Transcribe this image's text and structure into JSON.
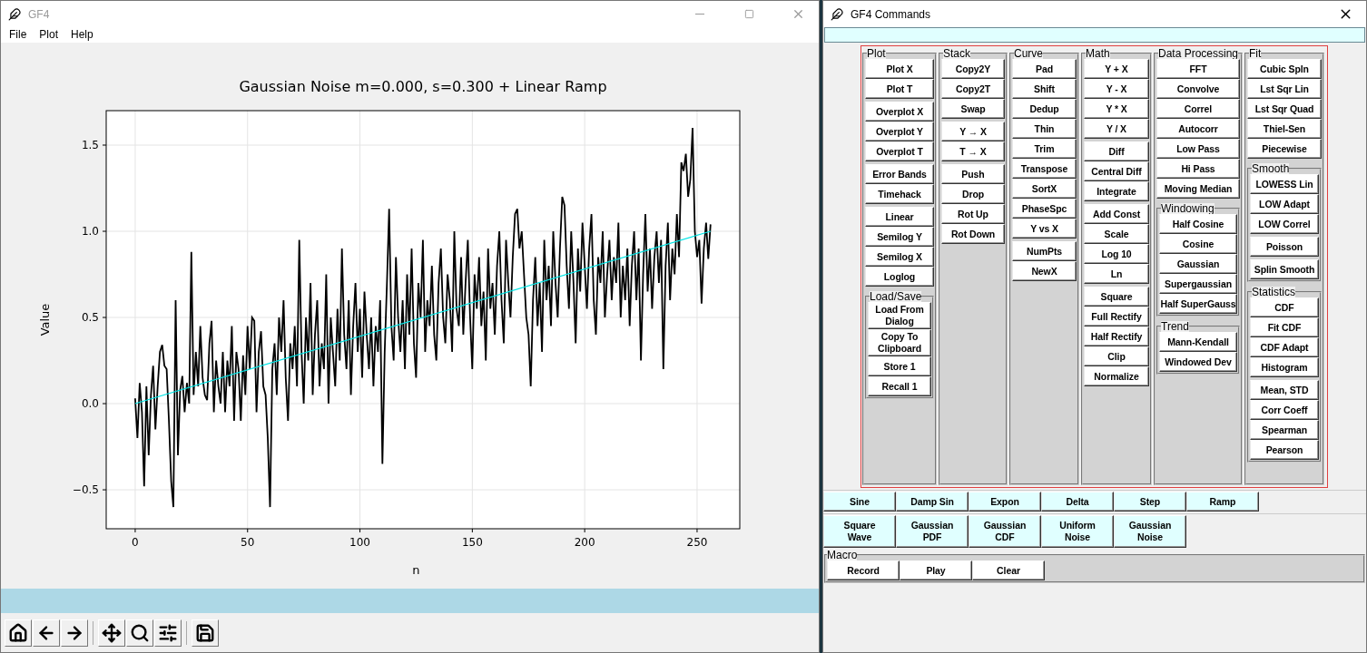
{
  "main_window": {
    "title": "GF4",
    "menu": [
      "File",
      "Plot",
      "Help"
    ],
    "plot": {
      "chart_data": {
        "type": "line",
        "title": "Gaussian Noise m=0.000, s=0.300 + Linear Ramp",
        "xlabel": "n",
        "ylabel": "Value",
        "x": [
          0,
          1,
          2,
          3,
          4,
          5,
          6,
          7,
          8,
          9,
          10,
          11,
          12,
          13,
          14,
          15,
          16,
          17,
          18,
          19,
          20,
          21,
          22,
          23,
          24,
          25,
          26,
          27,
          28,
          29,
          30,
          31,
          32,
          33,
          34,
          35,
          36,
          37,
          38,
          39,
          40,
          41,
          42,
          43,
          44,
          45,
          46,
          47,
          48,
          49,
          50,
          51,
          52,
          53,
          54,
          55,
          56,
          57,
          58,
          59,
          60,
          61,
          62,
          63,
          64,
          65,
          66,
          67,
          68,
          69,
          70,
          71,
          72,
          73,
          74,
          75,
          76,
          77,
          78,
          79,
          80,
          81,
          82,
          83,
          84,
          85,
          86,
          87,
          88,
          89,
          90,
          91,
          92,
          93,
          94,
          95,
          96,
          97,
          98,
          99,
          100,
          101,
          102,
          103,
          104,
          105,
          106,
          107,
          108,
          109,
          110,
          111,
          112,
          113,
          114,
          115,
          116,
          117,
          118,
          119,
          120,
          121,
          122,
          123,
          124,
          125,
          126,
          127,
          128,
          129,
          130,
          131,
          132,
          133,
          134,
          135,
          136,
          137,
          138,
          139,
          140,
          141,
          142,
          143,
          144,
          145,
          146,
          147,
          148,
          149,
          150,
          151,
          152,
          153,
          154,
          155,
          156,
          157,
          158,
          159,
          160,
          161,
          162,
          163,
          164,
          165,
          166,
          167,
          168,
          169,
          170,
          171,
          172,
          173,
          174,
          175,
          176,
          177,
          178,
          179,
          180,
          181,
          182,
          183,
          184,
          185,
          186,
          187,
          188,
          189,
          190,
          191,
          192,
          193,
          194,
          195,
          196,
          197,
          198,
          199,
          200,
          201,
          202,
          203,
          204,
          205,
          206,
          207,
          208,
          209,
          210,
          211,
          212,
          213,
          214,
          215,
          216,
          217,
          218,
          219,
          220,
          221,
          222,
          223,
          224,
          225,
          226,
          227,
          228,
          229,
          230,
          231,
          232,
          233,
          234,
          235,
          236,
          237,
          238,
          239,
          240,
          241,
          242,
          243,
          244,
          245,
          246,
          247,
          248,
          249,
          250,
          251,
          252,
          253,
          254,
          255,
          256
        ],
        "series": [
          {
            "color": "#000000",
            "values": [
              0.03,
              -0.2,
              0.12,
              -0.05,
              -0.48,
              0.1,
              -0.3,
              0.05,
              0.22,
              -0.15,
              0.1,
              0.3,
              0.34,
              0.22,
              0.2,
              -0.1,
              -0.45,
              -0.6,
              0.6,
              -0.3,
              0.08,
              0.16,
              -0.05,
              0.12,
              0.0,
              0.88,
              0.05,
              0.3,
              0.1,
              0.45,
              0.15,
              0.05,
              0.02,
              0.35,
              0.48,
              -0.05,
              0.25,
              0.1,
              0.0,
              0.3,
              -0.05,
              0.25,
              0.1,
              0.45,
              -0.1,
              0.3,
              0.2,
              -0.1,
              0.28,
              0.05,
              0.45,
              0.2,
              0.5,
              0.48,
              -0.05,
              0.3,
              0.42,
              0.1,
              0.05,
              -0.2,
              -0.6,
              0.2,
              0.35,
              0.05,
              0.5,
              0.3,
              0.6,
              0.15,
              -0.1,
              0.35,
              0.2,
              0.45,
              0.1,
              0.95,
              0.3,
              0.0,
              0.5,
              0.25,
              0.7,
              0.05,
              0.4,
              0.6,
              0.1,
              0.35,
              0.2,
              0.75,
              0.0,
              0.5,
              0.3,
              0.1,
              0.55,
              0.25,
              0.9,
              0.4,
              0.2,
              0.6,
              0.05,
              0.45,
              0.7,
              0.3,
              0.55,
              0.15,
              0.65,
              0.4,
              0.2,
              0.5,
              0.1,
              0.45,
              0.3,
              0.6,
              -0.35,
              0.3,
              0.7,
              1.13,
              0.45,
              0.25,
              0.85,
              0.5,
              0.3,
              0.6,
              0.2,
              0.75,
              0.4,
              0.9,
              0.35,
              0.15,
              0.7,
              0.5,
              0.95,
              0.3,
              0.6,
              0.45,
              0.8,
              0.4,
              0.25,
              0.7,
              0.9,
              0.5,
              0.35,
              0.75,
              0.6,
              0.3,
              1.0,
              0.55,
              0.45,
              0.85,
              0.4,
              0.7,
              0.95,
              0.5,
              0.2,
              0.75,
              0.55,
              0.85,
              0.45,
              0.65,
              0.25,
              0.9,
              0.55,
              0.7,
              0.4,
              0.8,
              1.0,
              0.6,
              0.35,
              0.95,
              0.7,
              0.5,
              0.85,
              1.1,
              1.13,
              0.9,
              1.0,
              0.75,
              0.5,
              0.4,
              0.1,
              0.6,
              0.85,
              0.45,
              0.7,
              0.3,
              0.95,
              0.6,
              0.8,
              0.45,
              1.0,
              0.7,
              0.5,
              0.9,
              1.2,
              1.15,
              0.8,
              0.55,
              1.0,
              0.7,
              0.35,
              0.9,
              0.65,
              1.05,
              0.8,
              0.55,
              0.9,
              1.1,
              0.6,
              0.4,
              0.85,
              0.7,
              1.0,
              0.5,
              0.75,
              0.95,
              0.6,
              0.85,
              0.7,
              1.05,
              0.5,
              0.8,
              0.6,
              0.9,
              0.45,
              0.8,
              1.0,
              0.6,
              0.9,
              0.25,
              0.75,
              1.1,
              0.65,
              0.9,
              0.55,
              0.85,
              1.0,
              0.7,
              0.95,
              0.2,
              0.8,
              1.05,
              0.6,
              0.9,
              0.75,
              1.1,
              0.85,
              1.4,
              1.35,
              1.45,
              1.2,
              1.3,
              1.6,
              1.0,
              0.85,
              0.95,
              0.58,
              0.9,
              1.05,
              0.84,
              1.04
            ]
          },
          {
            "color": "#00e5e5",
            "x": [
              0,
              256
            ],
            "values": [
              0.0,
              1.0
            ]
          }
        ],
        "grid": true,
        "xlim": [
          -12.9,
          269
        ],
        "ylim": [
          -0.726,
          1.7
        ],
        "xticks": [
          0,
          50,
          100,
          150,
          200,
          250
        ],
        "yticks": [
          {
            "value": -0.5,
            "label": "−0.5"
          },
          {
            "value": 0,
            "label": "0.0"
          },
          {
            "value": 0.5,
            "label": "0.5"
          },
          {
            "value": 1,
            "label": "1.0"
          },
          {
            "value": 1.5,
            "label": "1.5"
          }
        ]
      }
    },
    "toolbar": [
      {
        "kind": "home"
      },
      {
        "kind": "back"
      },
      {
        "kind": "forward"
      },
      {
        "kind": "separator"
      },
      {
        "kind": "pan"
      },
      {
        "kind": "zoom"
      },
      {
        "kind": "configure"
      },
      {
        "kind": "separator"
      },
      {
        "kind": "save"
      }
    ]
  },
  "commands_window": {
    "title": "GF4 Commands",
    "columns": [
      {
        "title": "Plot",
        "groups": [
          [
            "Plot X",
            "Plot T"
          ],
          [
            "Overplot X",
            "Overplot Y",
            "Overplot T"
          ],
          [
            "Error Bands",
            "Timehack"
          ],
          [
            "Linear",
            "Semilog Y",
            "Semilog X",
            "Loglog"
          ]
        ],
        "sections": [
          {
            "title": "Load/Save",
            "groups": [
              [
                "Load From\nDialog",
                "Copy To\nClipboard",
                "Store 1",
                "Recall 1"
              ]
            ]
          }
        ]
      },
      {
        "title": "Stack",
        "groups": [
          [
            "Copy2Y",
            "Copy2T",
            "Swap"
          ],
          [
            "Y → X",
            "T → X"
          ],
          [
            "Push",
            "Drop",
            "Rot Up",
            "Rot Down"
          ]
        ]
      },
      {
        "title": "Curve",
        "groups": [
          [
            "Pad",
            "Shift",
            "Dedup",
            "Thin",
            "Trim",
            "Transpose",
            "SortX",
            "PhaseSpc",
            "Y vs X"
          ],
          [
            "NumPts",
            "NewX"
          ]
        ]
      },
      {
        "title": "Math",
        "groups": [
          [
            "Y + X",
            "Y - X",
            "Y * X",
            "Y / X"
          ],
          [
            "Diff",
            "Central Diff",
            "Integrate"
          ],
          [
            "Add Const",
            "Scale",
            "Log 10",
            "Ln"
          ],
          [
            "Square",
            "Full Rectify",
            "Half Rectify",
            "Clip",
            "Normalize"
          ]
        ]
      },
      {
        "title": "Data Processing",
        "groups": [
          [
            "FFT",
            "Convolve",
            "Correl",
            "Autocorr",
            "Low Pass",
            "Hi Pass",
            "Moving Median"
          ]
        ],
        "sections": [
          {
            "title": "Windowing",
            "groups": [
              [
                "Half Cosine",
                "Cosine",
                "Gaussian",
                "Supergaussian",
                "Half SuperGauss"
              ]
            ]
          },
          {
            "title": "Trend",
            "groups": [
              [
                "Mann-Kendall",
                "Windowed Dev"
              ]
            ]
          }
        ]
      },
      {
        "title": "Fit",
        "groups": [
          [
            "Cubic Spln",
            "Lst Sqr Lin",
            "Lst Sqr Quad",
            "Thiel-Sen",
            "Piecewise"
          ]
        ],
        "sections": [
          {
            "title": "Smooth",
            "groups": [
              [
                "LOWESS Lin",
                "LOW Adapt",
                "LOW Correl"
              ],
              [
                "Poisson"
              ],
              [
                "Splin Smooth"
              ]
            ]
          },
          {
            "title": "Statistics",
            "groups": [
              [
                "CDF",
                "Fit CDF",
                "CDF Adapt",
                "Histogram"
              ],
              [
                "Mean, STD",
                "Corr Coeff",
                "Spearman",
                "Pearson"
              ]
            ]
          }
        ]
      }
    ],
    "generators": [
      [
        "Sine",
        "Damp Sin",
        "Expon",
        "Delta",
        "Step",
        "Ramp"
      ],
      [
        "Square\nWave",
        "Gaussian\nPDF",
        "Gaussian\nCDF",
        "Uniform\nNoise",
        "Gaussian\nNoise"
      ]
    ],
    "macro": {
      "title": "Macro",
      "buttons": [
        "Record",
        "Play",
        "Clear"
      ]
    }
  }
}
